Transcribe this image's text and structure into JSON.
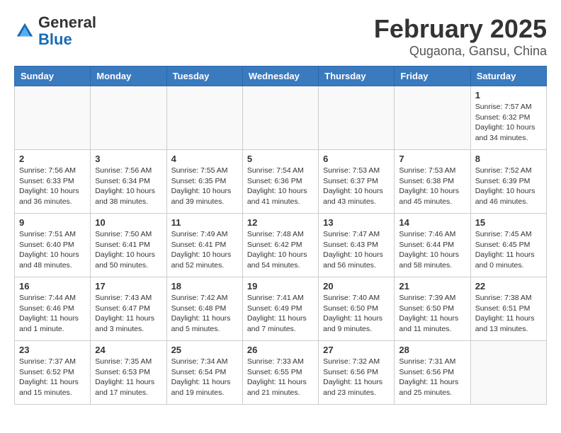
{
  "logo": {
    "general": "General",
    "blue": "Blue"
  },
  "title": "February 2025",
  "subtitle": "Qugaona, Gansu, China",
  "weekdays": [
    "Sunday",
    "Monday",
    "Tuesday",
    "Wednesday",
    "Thursday",
    "Friday",
    "Saturday"
  ],
  "weeks": [
    [
      {
        "day": "",
        "info": ""
      },
      {
        "day": "",
        "info": ""
      },
      {
        "day": "",
        "info": ""
      },
      {
        "day": "",
        "info": ""
      },
      {
        "day": "",
        "info": ""
      },
      {
        "day": "",
        "info": ""
      },
      {
        "day": "1",
        "info": "Sunrise: 7:57 AM\nSunset: 6:32 PM\nDaylight: 10 hours and 34 minutes."
      }
    ],
    [
      {
        "day": "2",
        "info": "Sunrise: 7:56 AM\nSunset: 6:33 PM\nDaylight: 10 hours and 36 minutes."
      },
      {
        "day": "3",
        "info": "Sunrise: 7:56 AM\nSunset: 6:34 PM\nDaylight: 10 hours and 38 minutes."
      },
      {
        "day": "4",
        "info": "Sunrise: 7:55 AM\nSunset: 6:35 PM\nDaylight: 10 hours and 39 minutes."
      },
      {
        "day": "5",
        "info": "Sunrise: 7:54 AM\nSunset: 6:36 PM\nDaylight: 10 hours and 41 minutes."
      },
      {
        "day": "6",
        "info": "Sunrise: 7:53 AM\nSunset: 6:37 PM\nDaylight: 10 hours and 43 minutes."
      },
      {
        "day": "7",
        "info": "Sunrise: 7:53 AM\nSunset: 6:38 PM\nDaylight: 10 hours and 45 minutes."
      },
      {
        "day": "8",
        "info": "Sunrise: 7:52 AM\nSunset: 6:39 PM\nDaylight: 10 hours and 46 minutes."
      }
    ],
    [
      {
        "day": "9",
        "info": "Sunrise: 7:51 AM\nSunset: 6:40 PM\nDaylight: 10 hours and 48 minutes."
      },
      {
        "day": "10",
        "info": "Sunrise: 7:50 AM\nSunset: 6:41 PM\nDaylight: 10 hours and 50 minutes."
      },
      {
        "day": "11",
        "info": "Sunrise: 7:49 AM\nSunset: 6:41 PM\nDaylight: 10 hours and 52 minutes."
      },
      {
        "day": "12",
        "info": "Sunrise: 7:48 AM\nSunset: 6:42 PM\nDaylight: 10 hours and 54 minutes."
      },
      {
        "day": "13",
        "info": "Sunrise: 7:47 AM\nSunset: 6:43 PM\nDaylight: 10 hours and 56 minutes."
      },
      {
        "day": "14",
        "info": "Sunrise: 7:46 AM\nSunset: 6:44 PM\nDaylight: 10 hours and 58 minutes."
      },
      {
        "day": "15",
        "info": "Sunrise: 7:45 AM\nSunset: 6:45 PM\nDaylight: 11 hours and 0 minutes."
      }
    ],
    [
      {
        "day": "16",
        "info": "Sunrise: 7:44 AM\nSunset: 6:46 PM\nDaylight: 11 hours and 1 minute."
      },
      {
        "day": "17",
        "info": "Sunrise: 7:43 AM\nSunset: 6:47 PM\nDaylight: 11 hours and 3 minutes."
      },
      {
        "day": "18",
        "info": "Sunrise: 7:42 AM\nSunset: 6:48 PM\nDaylight: 11 hours and 5 minutes."
      },
      {
        "day": "19",
        "info": "Sunrise: 7:41 AM\nSunset: 6:49 PM\nDaylight: 11 hours and 7 minutes."
      },
      {
        "day": "20",
        "info": "Sunrise: 7:40 AM\nSunset: 6:50 PM\nDaylight: 11 hours and 9 minutes."
      },
      {
        "day": "21",
        "info": "Sunrise: 7:39 AM\nSunset: 6:50 PM\nDaylight: 11 hours and 11 minutes."
      },
      {
        "day": "22",
        "info": "Sunrise: 7:38 AM\nSunset: 6:51 PM\nDaylight: 11 hours and 13 minutes."
      }
    ],
    [
      {
        "day": "23",
        "info": "Sunrise: 7:37 AM\nSunset: 6:52 PM\nDaylight: 11 hours and 15 minutes."
      },
      {
        "day": "24",
        "info": "Sunrise: 7:35 AM\nSunset: 6:53 PM\nDaylight: 11 hours and 17 minutes."
      },
      {
        "day": "25",
        "info": "Sunrise: 7:34 AM\nSunset: 6:54 PM\nDaylight: 11 hours and 19 minutes."
      },
      {
        "day": "26",
        "info": "Sunrise: 7:33 AM\nSunset: 6:55 PM\nDaylight: 11 hours and 21 minutes."
      },
      {
        "day": "27",
        "info": "Sunrise: 7:32 AM\nSunset: 6:56 PM\nDaylight: 11 hours and 23 minutes."
      },
      {
        "day": "28",
        "info": "Sunrise: 7:31 AM\nSunset: 6:56 PM\nDaylight: 11 hours and 25 minutes."
      },
      {
        "day": "",
        "info": ""
      }
    ]
  ]
}
